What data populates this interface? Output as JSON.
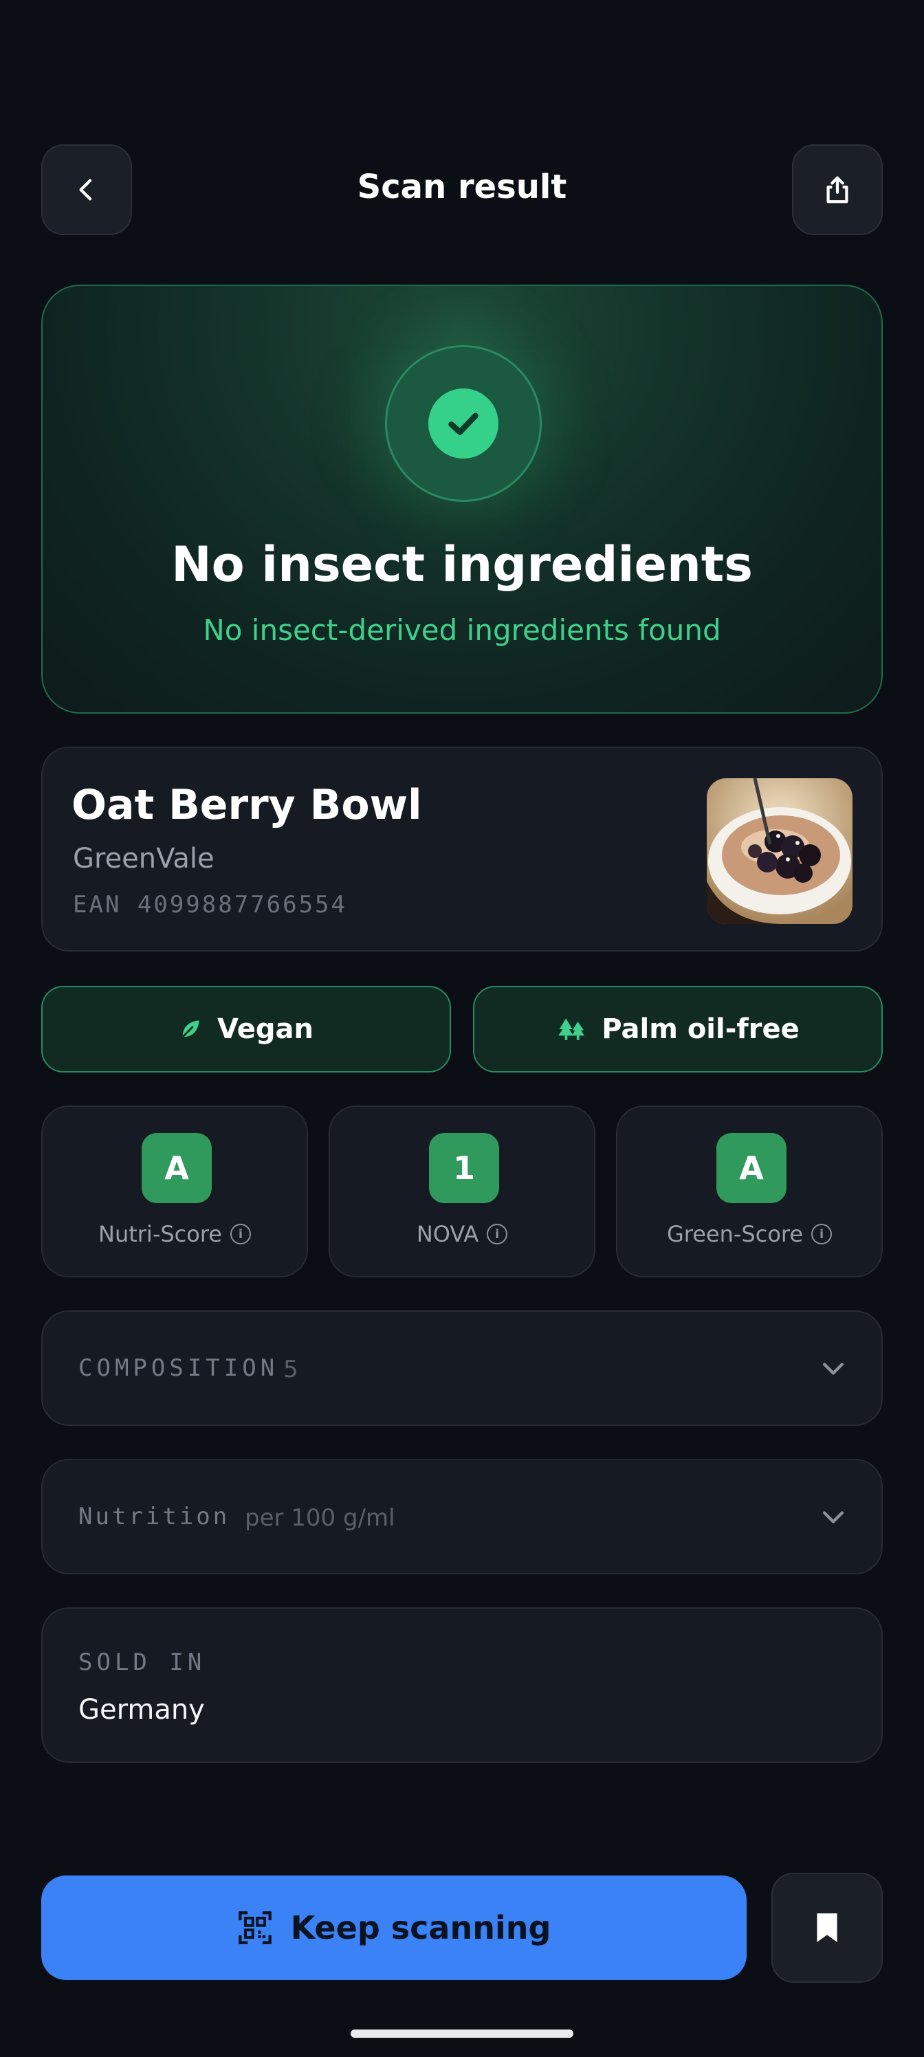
{
  "header": {
    "title": "Scan result",
    "back_icon": "chevron-left-icon",
    "share_icon": "share-icon"
  },
  "result": {
    "status": "safe",
    "title": "No insect ingredients",
    "subtitle": "No insect-derived ingredients found",
    "accent_color": "#35d08a"
  },
  "product": {
    "name": "Oat Berry Bowl",
    "brand": "GreenVale",
    "ean": "EAN 4099887766554",
    "image": "oat-berry-bowl-photo"
  },
  "tags": [
    {
      "label": "Vegan",
      "icon": "leaf-icon"
    },
    {
      "label": "Palm oil-free",
      "icon": "trees-icon"
    }
  ],
  "scores": [
    {
      "value": "A",
      "label": "Nutri-Score"
    },
    {
      "value": "1",
      "label": "NOVA"
    },
    {
      "value": "A",
      "label": "Green-Score"
    }
  ],
  "sections": {
    "composition": {
      "label": "COMPOSITION",
      "count": "5"
    },
    "nutrition": {
      "label": "Nutrition",
      "unit": "per 100 g/ml"
    },
    "sold_in": {
      "label": "SOLD IN",
      "value": "Germany"
    }
  },
  "actions": {
    "keep_scanning": "Keep scanning",
    "cta_color": "#3b82f6"
  }
}
